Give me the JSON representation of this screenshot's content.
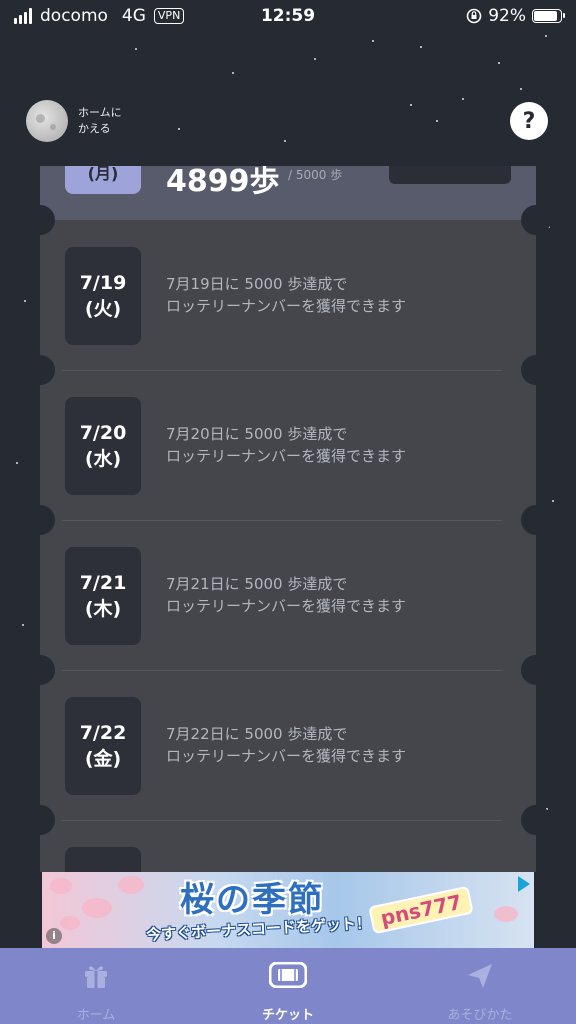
{
  "status_bar": {
    "carrier": "docomo",
    "network": "4G",
    "vpn": "VPN",
    "time": "12:59",
    "battery": "92%",
    "battery_level": 0.92
  },
  "header": {
    "home_label": "ホームに\nかえる",
    "help": "?"
  },
  "top_partial": {
    "date": "(月)",
    "steps": "4899歩",
    "target": "/ 5000 歩"
  },
  "tickets": [
    {
      "date": "7/19",
      "weekday": "(火)",
      "line1": "7月19日に 5000 歩達成で",
      "line2": "ロッテリーナンバーを獲得できます"
    },
    {
      "date": "7/20",
      "weekday": "(水)",
      "line1": "7月20日に 5000 歩達成で",
      "line2": "ロッテリーナンバーを獲得できます"
    },
    {
      "date": "7/21",
      "weekday": "(木)",
      "line1": "7月21日に 5000 歩達成で",
      "line2": "ロッテリーナンバーを獲得できます"
    },
    {
      "date": "7/22",
      "weekday": "(金)",
      "line1": "7月22日に 5000 歩達成で",
      "line2": "ロッテリーナンバーを獲得できます"
    }
  ],
  "ad": {
    "title": "桜の季節",
    "code": "pns777",
    "subtitle": "今すぐボーナスコードをゲット！",
    "info": "i"
  },
  "nav": {
    "items": [
      {
        "label": "ホーム",
        "icon": "gift-icon"
      },
      {
        "label": "チケット",
        "icon": "ticket-icon"
      },
      {
        "label": "あそびかた",
        "icon": "paper-plane-icon"
      }
    ]
  }
}
